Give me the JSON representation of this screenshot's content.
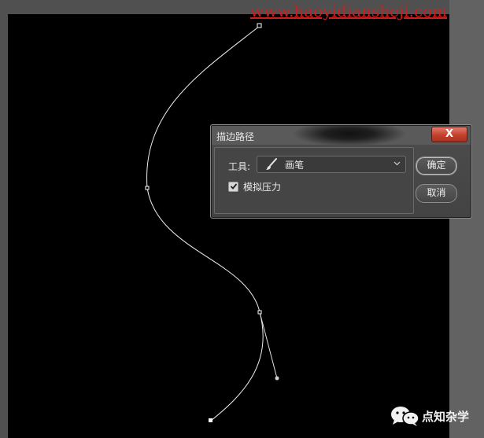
{
  "watermark": {
    "url": "www.haoyidiansheji.com"
  },
  "dialog": {
    "title": "描边路径",
    "close_label": "X",
    "tool_label": "工具:",
    "tool_value": "画笔",
    "simulate_pressure_label": "模拟压力",
    "simulate_pressure_checked": true,
    "ok_label": "确定",
    "cancel_label": "取消"
  },
  "credit": {
    "account_name": "点知杂学",
    "icon": "wechat-icon"
  },
  "colors": {
    "canvas": "#000000",
    "workspace": "#535353",
    "path_stroke": "#ffffff",
    "watermark": "#cc1f1f"
  }
}
